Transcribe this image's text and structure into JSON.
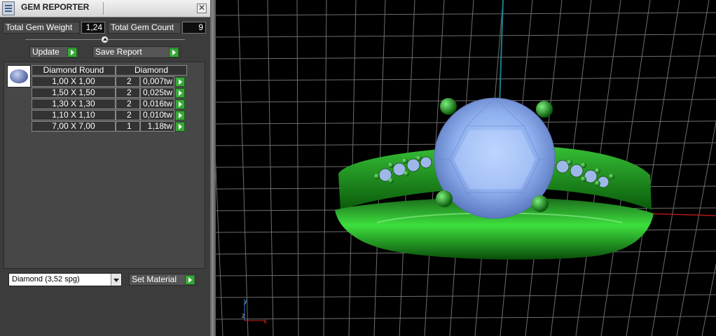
{
  "panel": {
    "title": "GEM REPORTER",
    "close_glyph": "✕",
    "total_weight_label": "Total Gem Weight",
    "total_weight_value": "1,24",
    "total_count_label": "Total Gem Count",
    "total_count_value": "9",
    "update_label": "Update",
    "save_report_label": "Save Report",
    "table": {
      "col_shape": "Diamond Round",
      "col_material": "Diamond",
      "rows": [
        {
          "size": "1,00 X 1,00",
          "count": "2",
          "weight": "0,007tw"
        },
        {
          "size": "1,50 X 1,50",
          "count": "2",
          "weight": "0,025tw"
        },
        {
          "size": "1,30 X 1,30",
          "count": "2",
          "weight": "0,016tw"
        },
        {
          "size": "1,10 X 1,10",
          "count": "2",
          "weight": "0,010tw"
        },
        {
          "size": "7,00 X 7,00",
          "count": "1",
          "weight": "1,18tw"
        }
      ]
    },
    "material_select": "Diamond     (3,52 spg)",
    "set_material_label": "Set Material"
  },
  "viewport": {
    "axis_y": "y",
    "axis_z": "z",
    "axis_x": "x"
  },
  "colors": {
    "panel_bg": "#3c3c3c",
    "accent_green": "#3aa83a",
    "ring_green": "#0c8a0c",
    "gem_blue": "#8fb0ef",
    "grid": "#6e6e6e"
  }
}
